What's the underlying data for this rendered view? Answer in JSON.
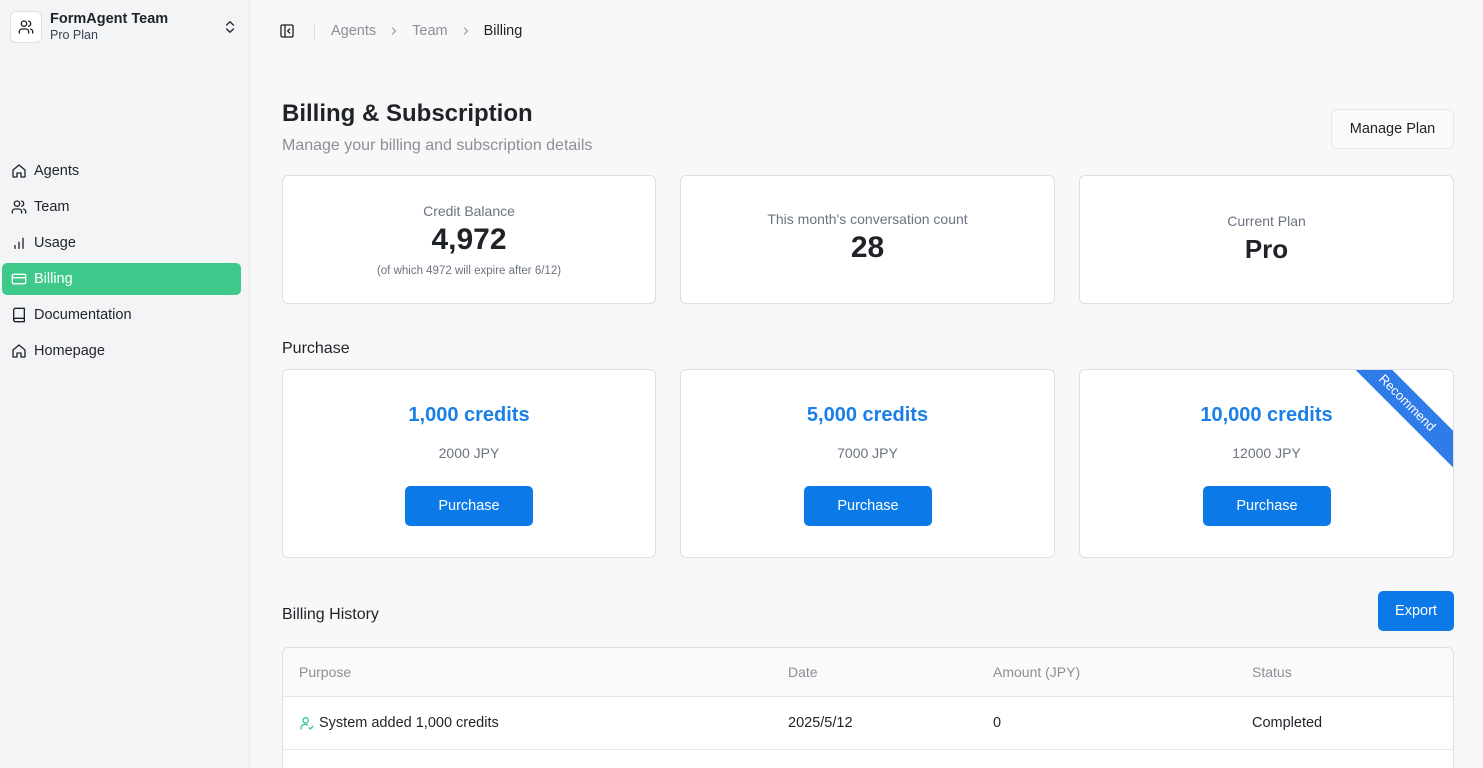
{
  "team": {
    "name": "FormAgent Team",
    "plan": "Pro Plan"
  },
  "nav": [
    {
      "label": "Agents",
      "icon": "home-icon",
      "active": false
    },
    {
      "label": "Team",
      "icon": "users-icon",
      "active": false
    },
    {
      "label": "Usage",
      "icon": "bar-chart-icon",
      "active": false
    },
    {
      "label": "Billing",
      "icon": "credit-card-icon",
      "active": true
    },
    {
      "label": "Documentation",
      "icon": "book-icon",
      "active": false
    },
    {
      "label": "Homepage",
      "icon": "home-icon",
      "active": false
    }
  ],
  "breadcrumb": [
    "Agents",
    "Team",
    "Billing"
  ],
  "header": {
    "title": "Billing & Subscription",
    "subtitle": "Manage your billing and subscription details",
    "manage_label": "Manage Plan"
  },
  "stats": {
    "credit": {
      "label": "Credit Balance",
      "value": "4,972",
      "note": "(of which 4972 will expire after 6/12)"
    },
    "conversations": {
      "label": "This month's conversation count",
      "value": "28"
    },
    "plan": {
      "label": "Current Plan",
      "value": "Pro"
    }
  },
  "purchase": {
    "title": "Purchase",
    "button_label": "Purchase",
    "packages": [
      {
        "credits": "1,000 credits",
        "price": "2000 JPY"
      },
      {
        "credits": "5,000 credits",
        "price": "7000 JPY"
      },
      {
        "credits": "10,000 credits",
        "price": "12000 JPY",
        "ribbon": "Recommend"
      }
    ]
  },
  "history": {
    "title": "Billing History",
    "export_label": "Export",
    "columns": [
      "Purpose",
      "Date",
      "Amount (JPY)",
      "Status"
    ],
    "rows": [
      {
        "purpose": "System added 1,000 credits",
        "date": "2025/5/12",
        "amount": "0",
        "status": "Completed"
      }
    ]
  },
  "colors": {
    "accent": "#3ec98a",
    "primary": "#0b7ae8",
    "ribbon": "#2f7be8"
  }
}
